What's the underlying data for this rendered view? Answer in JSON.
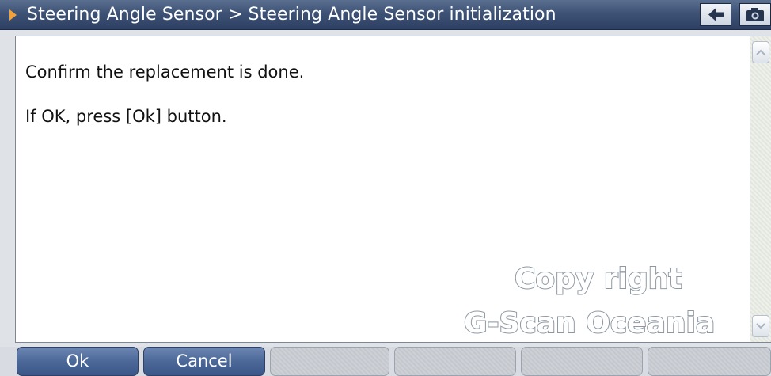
{
  "titlebar": {
    "title": "Steering Angle Sensor > Steering Angle Sensor initialization",
    "icons": [
      "back-arrow-icon",
      "camera-icon"
    ],
    "accent_color": "#f2a13a",
    "background_color": "#3e5275"
  },
  "content": {
    "messages": [
      "Confirm the replacement is done.",
      "If OK, press [Ok] button."
    ]
  },
  "watermark": {
    "line1": "Copy right",
    "line2": "G-Scan Oceania"
  },
  "buttonbar": {
    "buttons": [
      {
        "label": "Ok",
        "enabled": true
      },
      {
        "label": "Cancel",
        "enabled": true
      },
      {
        "label": "",
        "enabled": false
      },
      {
        "label": "",
        "enabled": false
      },
      {
        "label": "",
        "enabled": false
      },
      {
        "label": "",
        "enabled": false
      }
    ],
    "active_color": "#4b6898"
  }
}
